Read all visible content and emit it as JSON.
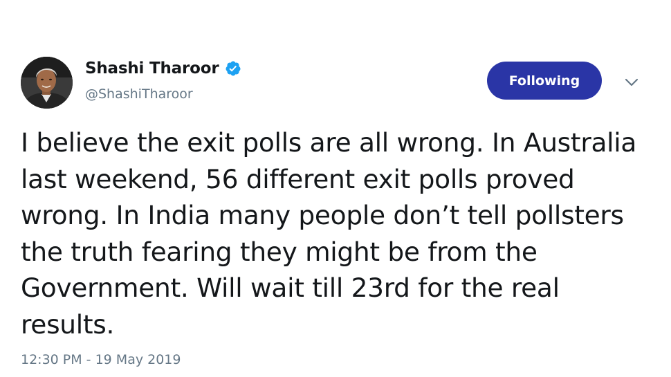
{
  "author": {
    "display_name": "Shashi Tharoor",
    "handle": "@ShashiTharoor",
    "verified": true,
    "avatar_icon": "profile-photo"
  },
  "actions": {
    "follow_label": "Following",
    "menu_icon": "chevron-down-icon"
  },
  "tweet": {
    "text": "I believe the exit polls are all wrong. In Australia last weekend, 56 different exit polls proved wrong. In India many people don’t tell pollsters the truth fearing they might be from the Government. Will wait till 23rd for the real results.",
    "timestamp": "12:30 PM - 19 May 2019"
  },
  "colors": {
    "follow_button_bg": "#2a35a6",
    "verified_badge": "#1da1f2",
    "secondary_text": "#657786",
    "primary_text": "#14171a"
  }
}
